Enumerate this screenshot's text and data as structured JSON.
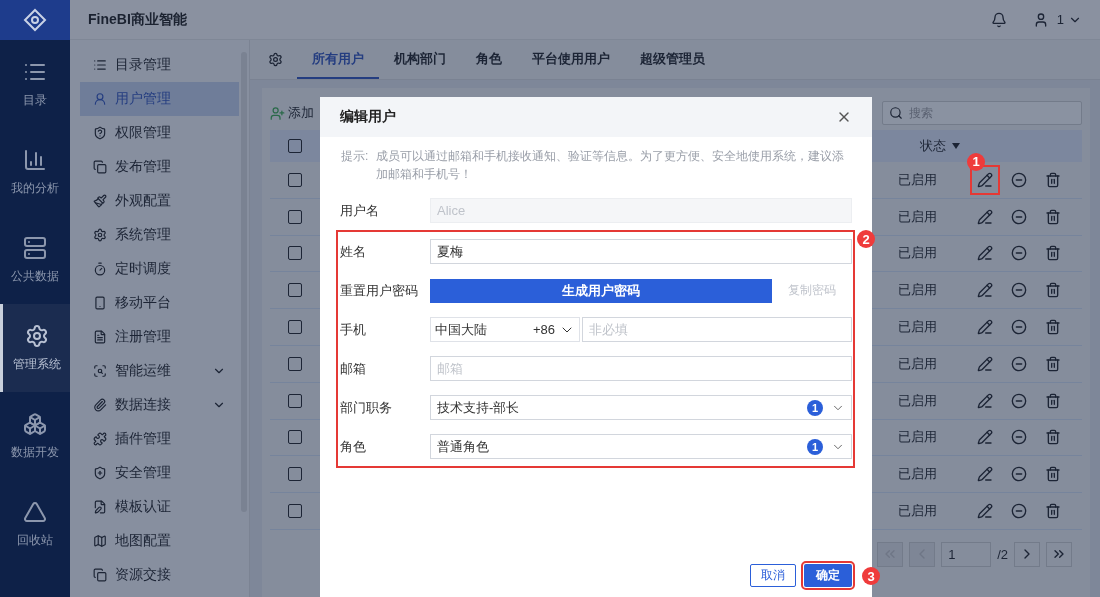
{
  "app": {
    "title": "FineBI商业智能",
    "user": "1"
  },
  "rail": [
    {
      "label": "目录",
      "selected": false
    },
    {
      "label": "我的分析",
      "selected": false
    },
    {
      "label": "公共数据",
      "selected": false
    },
    {
      "label": "管理系统",
      "selected": true
    },
    {
      "label": "数据开发",
      "selected": false
    },
    {
      "label": "回收站",
      "selected": false
    }
  ],
  "menu": [
    {
      "label": "目录管理",
      "selected": false,
      "expandable": false
    },
    {
      "label": "用户管理",
      "selected": true,
      "expandable": false
    },
    {
      "label": "权限管理",
      "selected": false,
      "expandable": false
    },
    {
      "label": "发布管理",
      "selected": false,
      "expandable": false
    },
    {
      "label": "外观配置",
      "selected": false,
      "expandable": false
    },
    {
      "label": "系统管理",
      "selected": false,
      "expandable": false
    },
    {
      "label": "定时调度",
      "selected": false,
      "expandable": false
    },
    {
      "label": "移动平台",
      "selected": false,
      "expandable": false
    },
    {
      "label": "注册管理",
      "selected": false,
      "expandable": false
    },
    {
      "label": "智能运维",
      "selected": false,
      "expandable": true
    },
    {
      "label": "数据连接",
      "selected": false,
      "expandable": true
    },
    {
      "label": "插件管理",
      "selected": false,
      "expandable": false
    },
    {
      "label": "安全管理",
      "selected": false,
      "expandable": false
    },
    {
      "label": "模板认证",
      "selected": false,
      "expandable": false
    },
    {
      "label": "地图配置",
      "selected": false,
      "expandable": false
    },
    {
      "label": "资源交接",
      "selected": false,
      "expandable": false
    }
  ],
  "tabs": [
    {
      "label": "所有用户",
      "selected": true
    },
    {
      "label": "机构部门",
      "selected": false
    },
    {
      "label": "角色",
      "selected": false
    },
    {
      "label": "平台使用用户",
      "selected": false
    },
    {
      "label": "超级管理员",
      "selected": false
    }
  ],
  "toolbar": {
    "add": "添加",
    "search_placeholder": "搜索"
  },
  "table": {
    "status_header": "状态",
    "header_checked": false,
    "rows": [
      {
        "status": "已启用",
        "checked": false,
        "highlighted": true
      },
      {
        "status": "已启用",
        "checked": false,
        "highlighted": false
      },
      {
        "status": "已启用",
        "checked": false,
        "highlighted": false
      },
      {
        "status": "已启用",
        "checked": false,
        "highlighted": false
      },
      {
        "status": "已启用",
        "checked": false,
        "highlighted": false
      },
      {
        "status": "已启用",
        "checked": false,
        "highlighted": false
      },
      {
        "status": "已启用",
        "checked": false,
        "highlighted": false
      },
      {
        "status": "已启用",
        "checked": false,
        "highlighted": false
      },
      {
        "status": "已启用",
        "checked": false,
        "highlighted": false
      },
      {
        "status": "已启用",
        "checked": false,
        "highlighted": false
      }
    ]
  },
  "pagination": {
    "page": "1",
    "total": "/2"
  },
  "dialog": {
    "title": "编辑用户",
    "hint_label": "提示:",
    "hint": "成员可以通过邮箱和手机接收通知、验证等信息。为了更方便、安全地使用系统，建议添加邮箱和手机号！",
    "fields": [
      {
        "kind": "input",
        "label": "用户名",
        "placeholder": "Alice",
        "disabled": true
      }
    ],
    "highlight_box": {
      "fields": [
        {
          "kind": "input",
          "label": "姓名",
          "value": "夏梅",
          "disabled": false
        },
        {
          "kind": "password",
          "label": "重置用户密码",
          "button": "生成用户密码",
          "copy": "复制密码",
          "copy_disabled": true
        },
        {
          "kind": "phone",
          "label": "手机",
          "region": "中国大陆",
          "code": "+86",
          "placeholder": "非必填"
        },
        {
          "kind": "input",
          "label": "邮箱",
          "placeholder": "邮箱",
          "disabled": false
        },
        {
          "kind": "select",
          "label": "部门职务",
          "value": "技术支持-部长",
          "count": "1"
        },
        {
          "kind": "select",
          "label": "角色",
          "value": "普通角色",
          "count": "1"
        }
      ]
    },
    "cancel": "取消",
    "ok": "确定",
    "ok_highlighted": true
  },
  "callouts": [
    {
      "number": "1"
    },
    {
      "number": "2"
    },
    {
      "number": "3"
    }
  ]
}
